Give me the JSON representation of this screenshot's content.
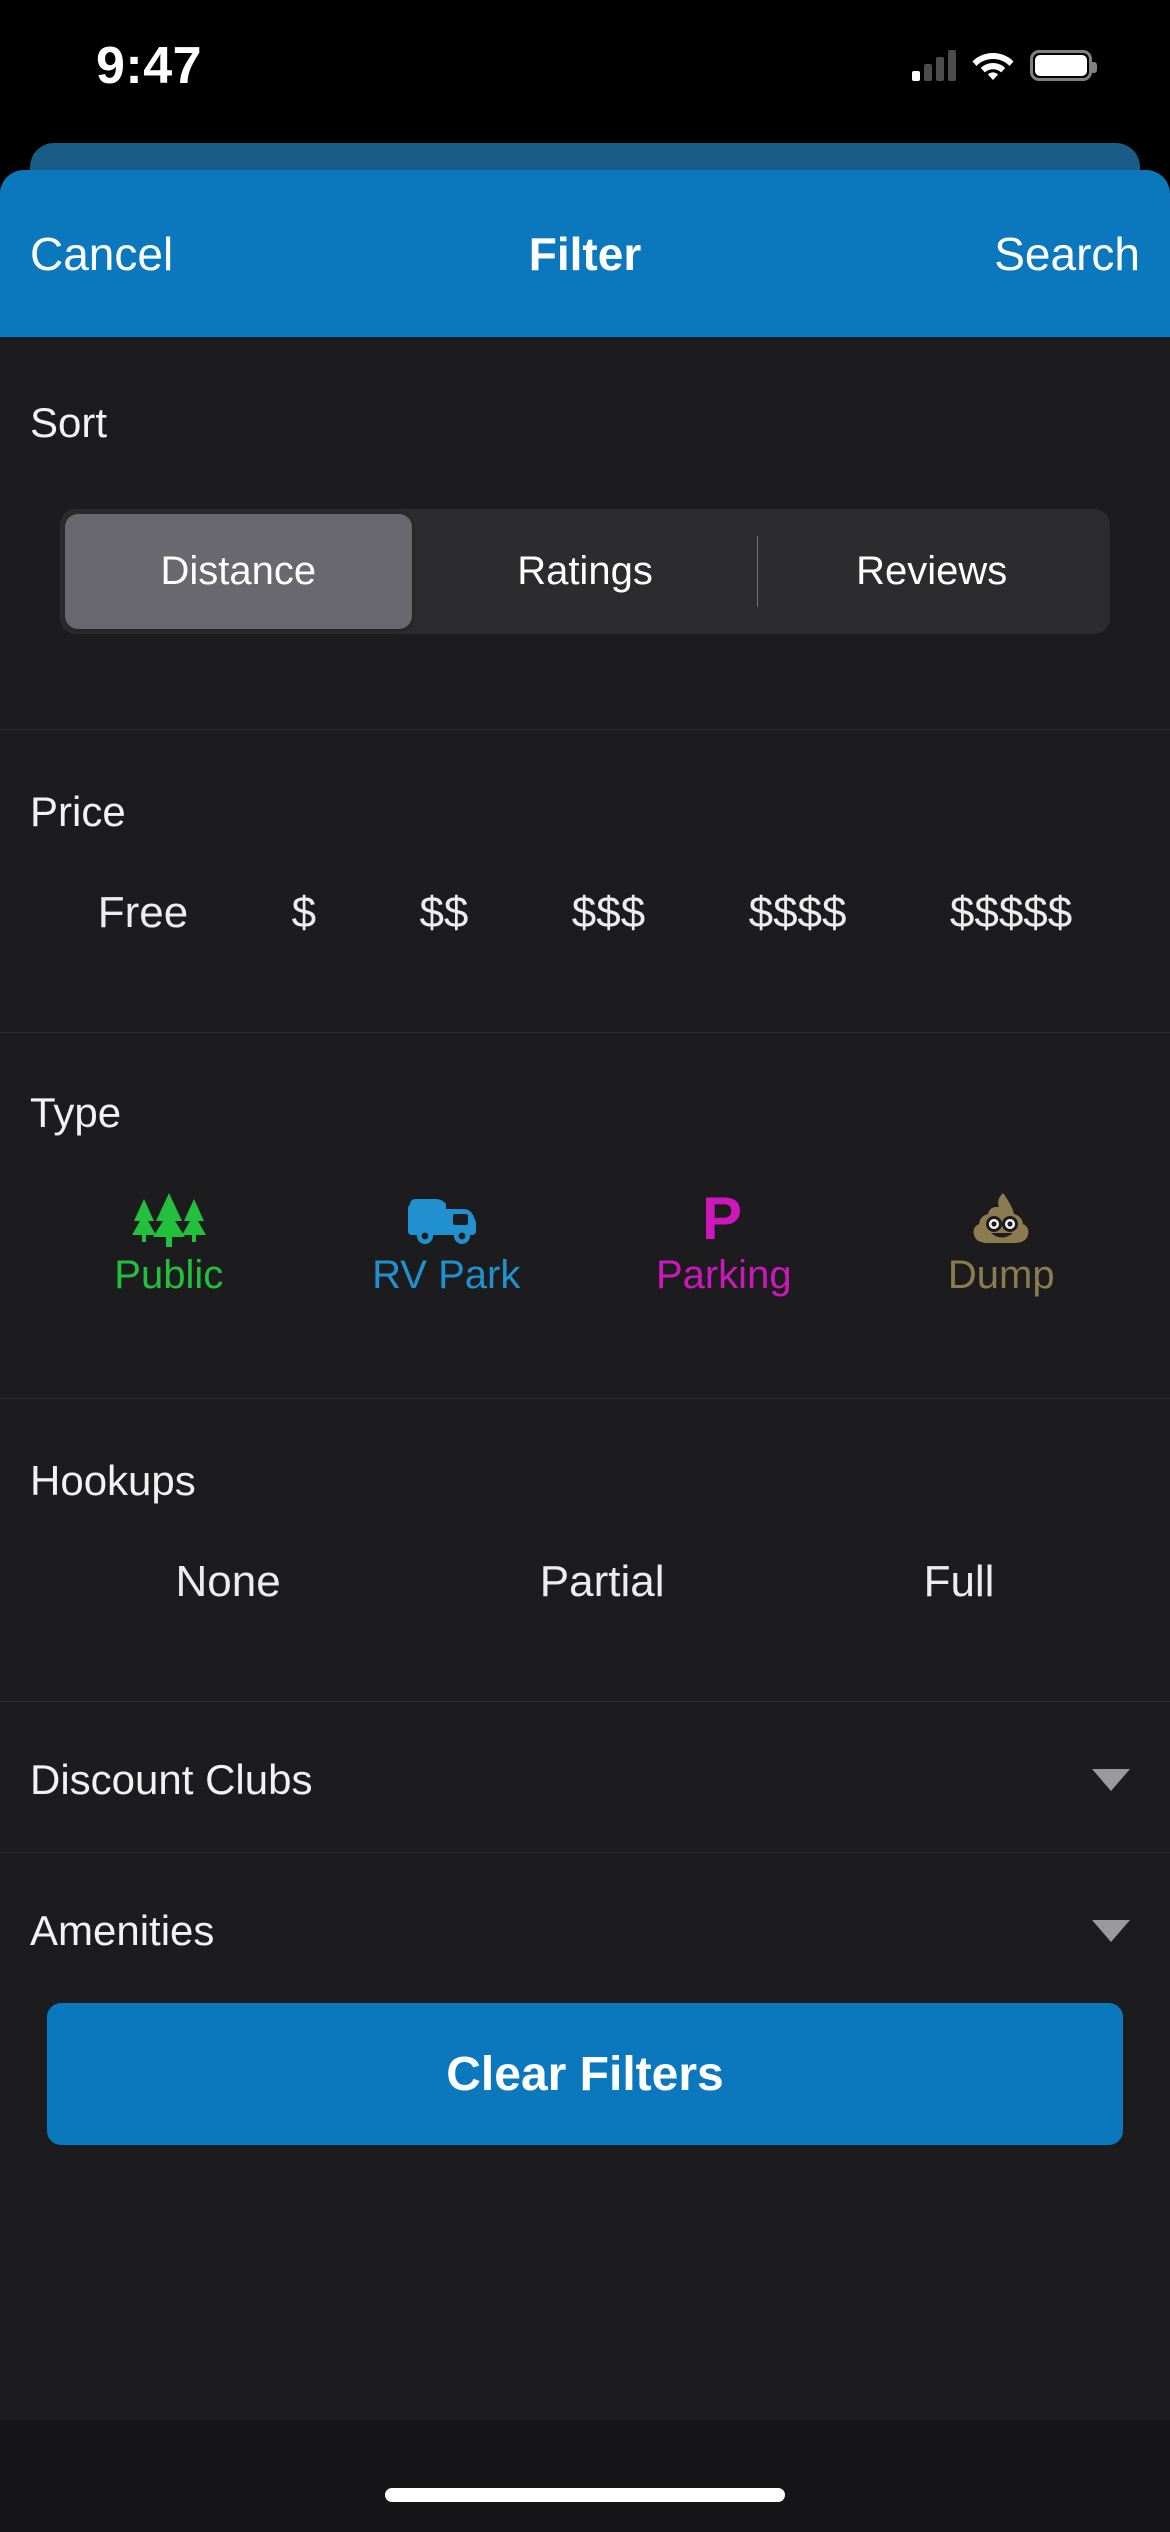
{
  "status_bar": {
    "time": "9:47",
    "signal_icon": "cellular-signal-icon",
    "wifi_icon": "wifi-icon",
    "battery_icon": "battery-icon"
  },
  "header": {
    "cancel_label": "Cancel",
    "title": "Filter",
    "search_label": "Search",
    "background_color": "#0B78BE"
  },
  "sections": {
    "sort": {
      "label": "Sort",
      "options": [
        {
          "label": "Distance",
          "selected": true
        },
        {
          "label": "Ratings",
          "selected": false
        },
        {
          "label": "Reviews",
          "selected": false
        }
      ],
      "selected_color": "#68686E",
      "track_color": "#2C2C2E"
    },
    "price": {
      "label": "Price",
      "options": [
        {
          "label": "Free",
          "selected": false
        },
        {
          "label": "$",
          "selected": false
        },
        {
          "label": "$$",
          "selected": false
        },
        {
          "label": "$$$",
          "selected": false
        },
        {
          "label": "$$$$",
          "selected": false
        },
        {
          "label": "$$$$$",
          "selected": false
        }
      ]
    },
    "type": {
      "label": "Type",
      "options": [
        {
          "label": "Public",
          "icon": "pine-trees-icon",
          "color": "#22C03C"
        },
        {
          "label": "RV Park",
          "icon": "rv-camper-icon",
          "color": "#2090CE"
        },
        {
          "label": "Parking",
          "icon": "parking-p-icon",
          "color": "#CC18BB"
        },
        {
          "label": "Dump",
          "icon": "poop-emoji-icon",
          "color": "#8B7B4E"
        }
      ]
    },
    "hookups": {
      "label": "Hookups",
      "options": [
        {
          "label": "None",
          "selected": false
        },
        {
          "label": "Partial",
          "selected": false
        },
        {
          "label": "Full",
          "selected": false
        }
      ]
    },
    "discount_clubs": {
      "label": "Discount Clubs",
      "caret_icon": "chevron-down-icon",
      "expanded": false
    },
    "amenities": {
      "label": "Amenities",
      "caret_icon": "chevron-down-icon",
      "expanded": false
    }
  },
  "footer": {
    "clear_filters_label": "Clear Filters",
    "button_color": "#0B78BE"
  }
}
